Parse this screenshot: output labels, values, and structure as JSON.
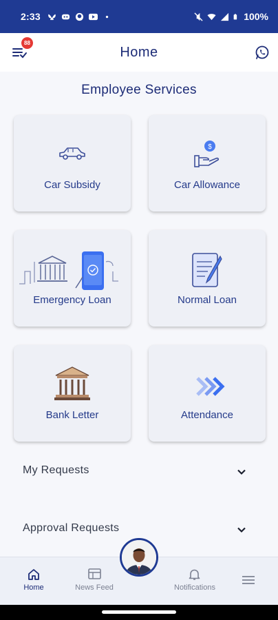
{
  "status_bar": {
    "time": "2:33",
    "battery": "100%",
    "notification_icons": [
      "bluesky-icon",
      "discord-icon",
      "github-icon",
      "youtube-icon",
      "dot-icon"
    ],
    "system_icons": [
      "mute-icon",
      "wifi-icon",
      "signal-icon",
      "battery-icon"
    ]
  },
  "header": {
    "title": "Home",
    "badge_count": "88"
  },
  "section": {
    "title": "Employee Services"
  },
  "services": [
    {
      "label": "Car Subsidy",
      "icon": "car-icon"
    },
    {
      "label": "Car Allowance",
      "icon": "hand-coin-icon"
    },
    {
      "label": "Emergency Loan",
      "icon": "phone-bank-icon"
    },
    {
      "label": "Normal Loan",
      "icon": "document-pen-icon"
    },
    {
      "label": "Bank Letter",
      "icon": "bank-icon"
    },
    {
      "label": "Attendance",
      "icon": "chevrons-right-icon"
    }
  ],
  "accordions": [
    {
      "label": "My Requests"
    },
    {
      "label": "Approval Requests"
    }
  ],
  "bottom_nav": {
    "home": "Home",
    "news_feed": "News Feed",
    "notifications": "Notifications"
  },
  "colors": {
    "primary": "#1f3a93",
    "accent": "#4a7cf0",
    "card_bg": "#eef0f6",
    "badge": "#e53935"
  }
}
